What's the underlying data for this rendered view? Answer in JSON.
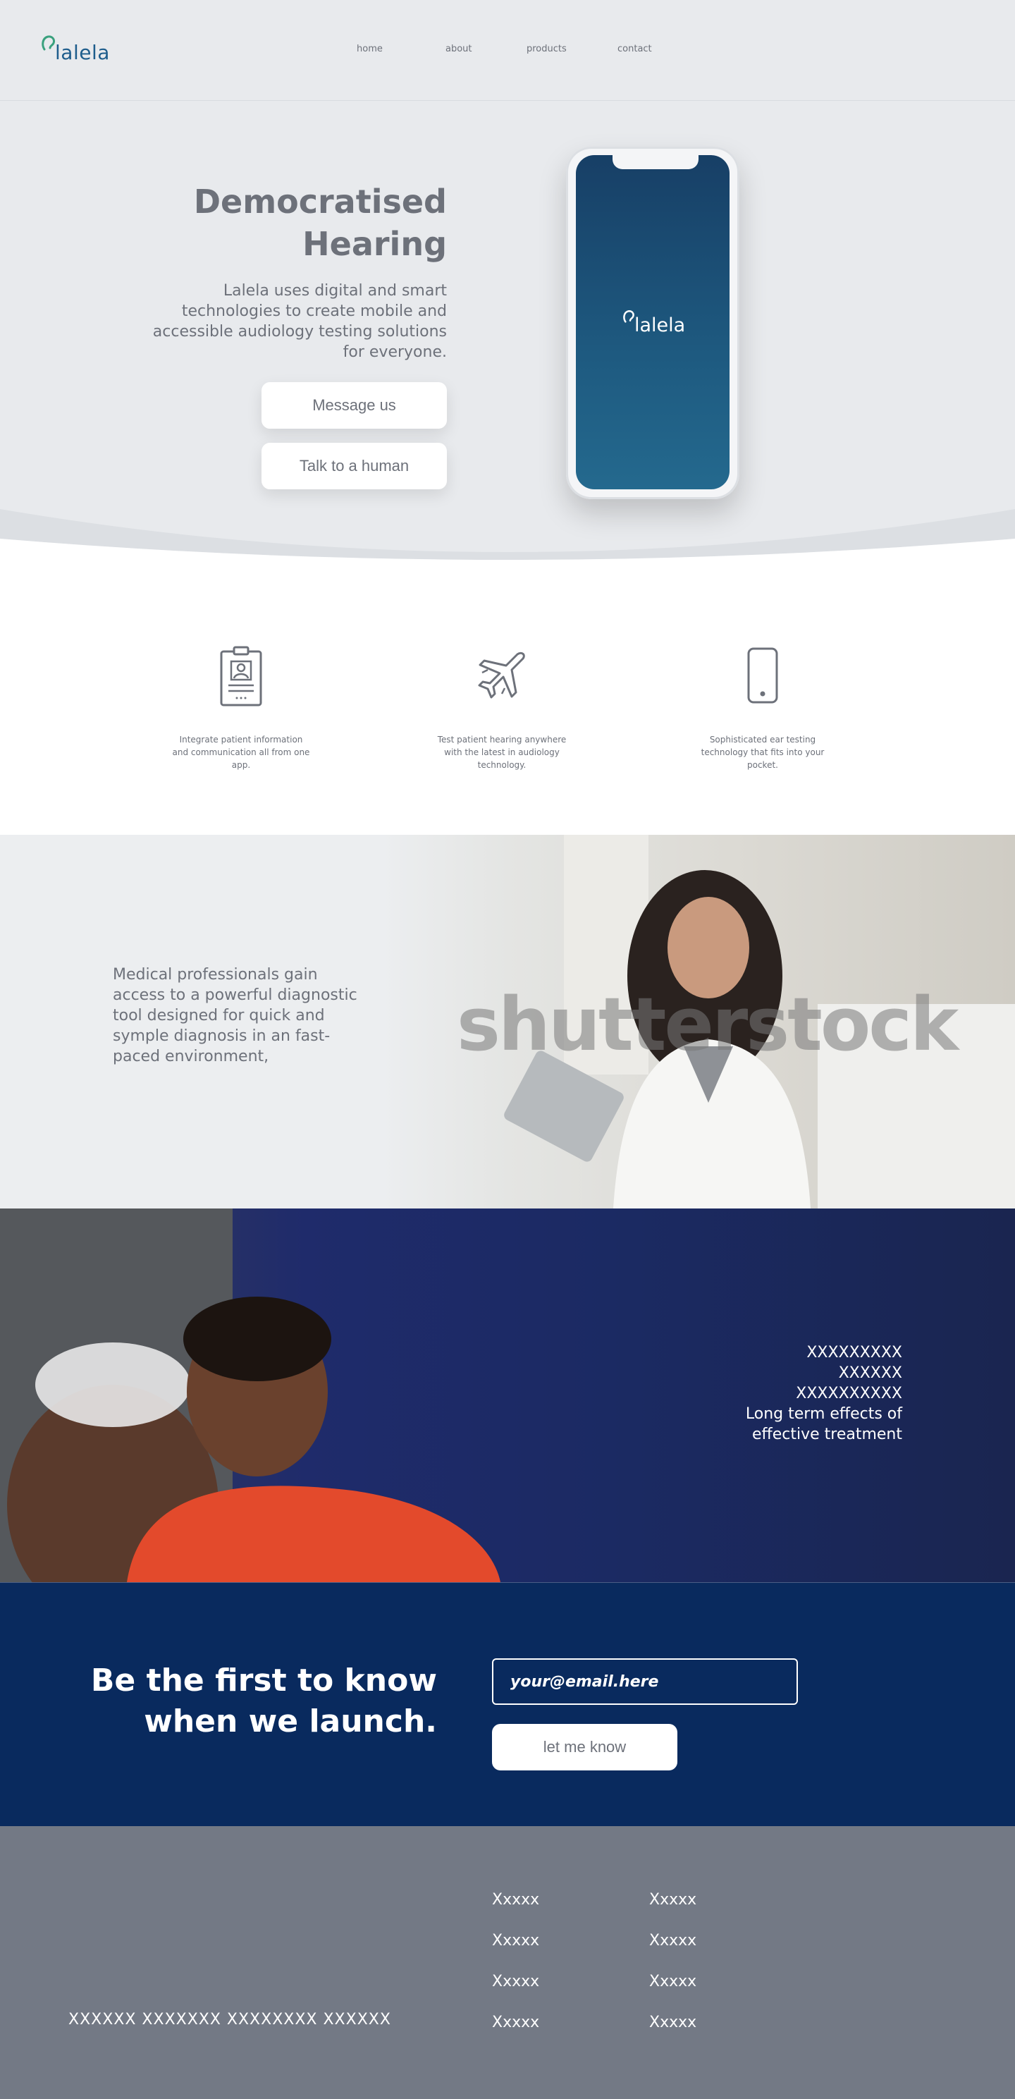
{
  "nav": {
    "logo_text": "lalela",
    "links": [
      "home",
      "about",
      "products",
      "contact"
    ]
  },
  "hero": {
    "title_line1": "Democratised",
    "title_line2": "Hearing",
    "description": "Lalela uses digital and smart technologies to create mobile and accessible audiology testing solutions for everyone.",
    "btn_message": "Message us",
    "btn_talk": "Talk to a human",
    "phone_logo_text": "lalela"
  },
  "features": [
    {
      "icon": "id-badge-icon",
      "text": "Integrate patient information and communication all from one app."
    },
    {
      "icon": "airplane-icon",
      "text": "Test patient hearing anywhere with the latest in audiology technology."
    },
    {
      "icon": "smartphone-icon",
      "text": "Sophisticated ear testing technology that fits into your pocket."
    }
  ],
  "doctor": {
    "text": "Medical professionals gain access to a powerful diagnostic tool designed for quick and symple diagnosis in an fast-paced environment,",
    "watermark": "shutterstock"
  },
  "family": {
    "lines": [
      "XXXXXXXXX",
      "XXXXXX",
      "XXXXXXXXXX",
      "Long term  effects of",
      "effective treatment"
    ]
  },
  "launch": {
    "title_line1": "Be the first to know",
    "title_line2": "when we launch.",
    "email_placeholder": "your@email.here",
    "btn_label": "let me know"
  },
  "footer": {
    "tagline": "XXXXXX XXXXXXX XXXXXXXX XXXXXX",
    "col1": [
      "Xxxxx",
      "Xxxxx",
      "Xxxxx",
      "Xxxxx"
    ],
    "col2": [
      "Xxxxx",
      "Xxxxx",
      "Xxxxx",
      "Xxxxx"
    ]
  },
  "colors": {
    "brand_blue": "#1e5d8c",
    "brand_green": "#3aa17e",
    "navy": "#092a5e",
    "footer_gray": "#737985",
    "text_gray": "#6d717a"
  }
}
